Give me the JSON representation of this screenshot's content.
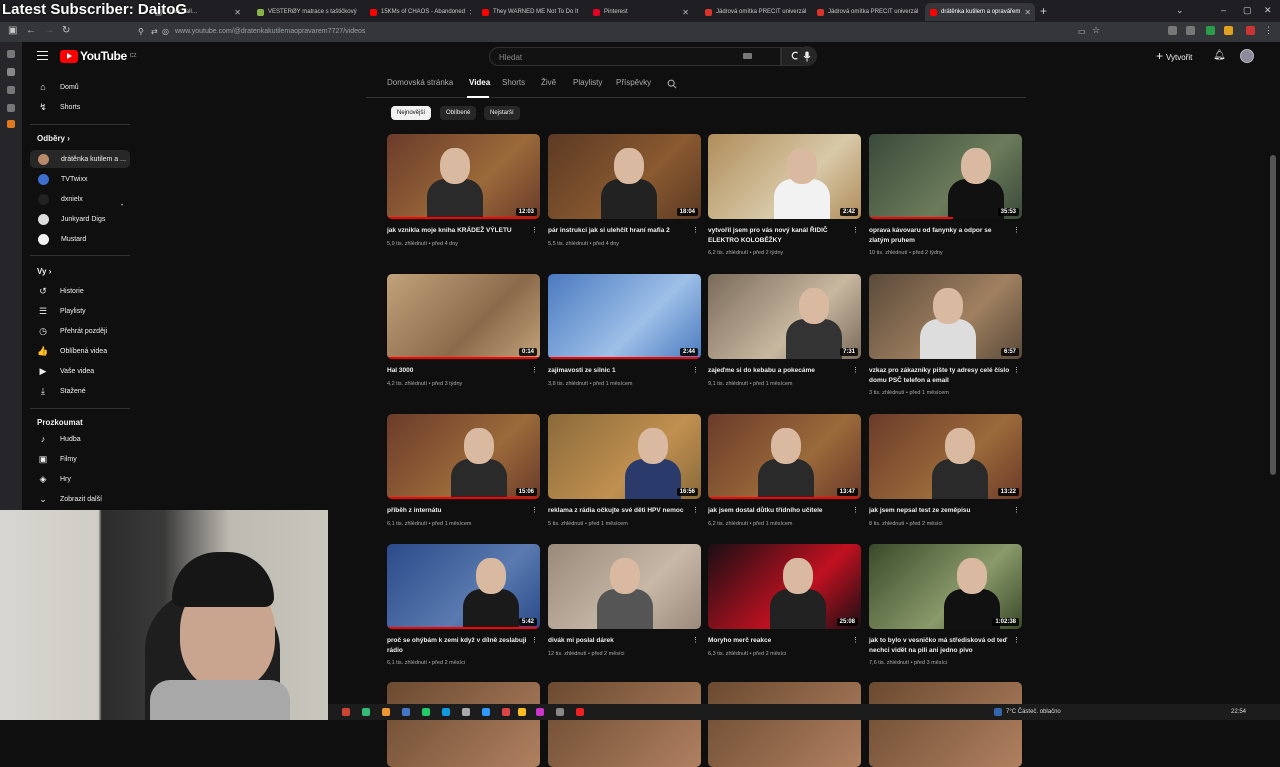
{
  "overlay": {
    "title": "Latest Subscriber: DaitoG"
  },
  "browser": {
    "tabs": [
      {
        "label": "Track, fall…",
        "color": "#6b6b6b",
        "active": false
      },
      {
        "label": "VESTERØY matrace s taštičkový",
        "color": "#8ab34a",
        "active": false
      },
      {
        "label": "15KMs of CHAOS - Abandoned",
        "color": "#ff0000",
        "active": false
      },
      {
        "label": "They WARNED ME Not To Do It",
        "color": "#ff0000",
        "active": false
      },
      {
        "label": "Pinterest",
        "color": "#e60023",
        "active": false
      },
      {
        "label": "Jádrová omítka PRECIT univerzál",
        "color": "#d9342b",
        "active": false
      },
      {
        "label": "Jádrová omítka PRECIT univerzál",
        "color": "#d9342b",
        "active": false
      },
      {
        "label": "drátěnka kutilem a opravářem",
        "color": "#ff0000",
        "active": true
      }
    ],
    "url": "www.youtube.com/@dratenkakutilemaopravarem7727/videos"
  },
  "masthead": {
    "logo_text": "YouTube",
    "logo_country": "CZ",
    "search_placeholder": "Hledat",
    "create_label": "Vytvořit"
  },
  "sidebar": {
    "home": "Domů",
    "shorts": "Shorts",
    "subs_header": "Odběry",
    "subscriptions": [
      {
        "label": "drátěnka kutilem a ...",
        "color": "#b88a6a"
      },
      {
        "label": "TVTwixx",
        "color": "#3d6fd1"
      },
      {
        "label": "dxnielx",
        "color": "#222222"
      },
      {
        "label": "Junkyard Digs",
        "color": "#dddddd"
      },
      {
        "label": "Mustard",
        "color": "#f2f2f2"
      }
    ],
    "you_header": "Vy",
    "you_items": [
      {
        "label": "Historie",
        "icon": "history-icon",
        "glyph": "↺"
      },
      {
        "label": "Playlisty",
        "icon": "playlist-icon",
        "glyph": "☰"
      },
      {
        "label": "Přehrát později",
        "icon": "clock-icon",
        "glyph": "◷"
      },
      {
        "label": "Oblíbená videa",
        "icon": "thumb-up-icon",
        "glyph": "👍"
      },
      {
        "label": "Vaše videa",
        "icon": "your-videos-icon",
        "glyph": "▶"
      },
      {
        "label": "Stažené",
        "icon": "download-icon",
        "glyph": "⤓"
      }
    ],
    "explore_header": "Prozkoumat",
    "explore_items": [
      {
        "label": "Hudba",
        "icon": "music-icon",
        "glyph": "♪"
      },
      {
        "label": "Filmy",
        "icon": "film-icon",
        "glyph": "▣"
      },
      {
        "label": "Hry",
        "icon": "gaming-icon",
        "glyph": "◈"
      },
      {
        "label": "Zobrazit další",
        "icon": "chevron-down-icon",
        "glyph": "⌄"
      }
    ]
  },
  "channel_tabs": [
    "Domovská stránka",
    "Videa",
    "Shorts",
    "Živě",
    "Playlisty",
    "Příspěvky"
  ],
  "chips": [
    "Nejnovější",
    "Oblíbené",
    "Nejstarší"
  ],
  "videos": [
    {
      "title": "jak vznikla moje kniha KRÁDEŽ VÝLETU",
      "meta": "5,9 tis. zhlédnutí • před 4 dny",
      "duration": "12:03",
      "progress": 1.0
    },
    {
      "title": "pár instrukcí jak si ulehčit hraní mafia 2",
      "meta": "5,5 tis. zhlédnutí • před 4 dny",
      "duration": "18:04",
      "progress": 0
    },
    {
      "title": "vytvořil jsem pro vás nový kanál ŘIDIČ ELEKTRO KOLOBĚŽKY",
      "meta": "6,2 tis. zhlédnutí • před 2 týdny",
      "duration": "2:42",
      "progress": 0
    },
    {
      "title": "oprava kávovaru od fanynky a odpor se zlatým pruhem",
      "meta": "10 tis. zhlédnutí • před 2 týdny",
      "duration": "35:53",
      "progress": 0.55
    },
    {
      "title": "Hal 3000",
      "meta": "4,2 tis. zhlédnutí • před 3 týdny",
      "duration": "0:14",
      "progress": 1.0
    },
    {
      "title": "zajímavosti ze silnic 1",
      "meta": "3,8 tis. zhlédnutí • před 1 měsícem",
      "duration": "2:44",
      "progress": 1.0
    },
    {
      "title": "zajeďme si do kebabu a pokecáme",
      "meta": "9,1 tis. zhlédnutí • před 1 měsícem",
      "duration": "7:31",
      "progress": 0
    },
    {
      "title": "vzkaz pro zákazníky pište ty adresy celé číslo domu PSČ telefon a email",
      "meta": "3 tis. zhlédnutí • před 1 měsícem",
      "duration": "6:57",
      "progress": 0
    },
    {
      "title": "příběh z internátu",
      "meta": "6,1 tis. zhlédnutí • před 1 měsícem",
      "duration": "15:06",
      "progress": 1.0
    },
    {
      "title": "reklama z rádia očkujte své děti HPV nemoc",
      "meta": "5 tis. zhlédnutí • před 1 měsícem",
      "duration": "16:56",
      "progress": 0
    },
    {
      "title": "jak jsem dostal důtku třídního učitele",
      "meta": "6,2 tis. zhlédnutí • před 1 měsícem",
      "duration": "13:47",
      "progress": 1.0
    },
    {
      "title": "jak jsem nepsal test ze zeměpisu",
      "meta": "8 tis. zhlédnutí • před 2 měsíci",
      "duration": "13:22",
      "progress": 0
    },
    {
      "title": "proč se ohýbám k zemi když v dílně zeslabuji rádio",
      "meta": "6,1 tis. zhlédnutí • před 2 měsíci",
      "duration": "5:42",
      "progress": 1.0
    },
    {
      "title": "divák mi poslal dárek",
      "meta": "12 tis. zhlédnutí • před 2 měsíci",
      "duration": "",
      "progress": 0
    },
    {
      "title": "Moryho merč reakce",
      "meta": "6,3 tis. zhlédnutí • před 2 měsíci",
      "duration": "25:08",
      "progress": 0
    },
    {
      "title": "jak to bylo v vesničko má středisková od teď nechci vidět na pili ani jedno pivo",
      "meta": "7,6 tis. zhlédnutí • před 3 měsíci",
      "duration": "1:02:38",
      "progress": 0
    }
  ],
  "taskbar": {
    "weather": "7°C  Částeč. oblačno",
    "time": "22:54"
  }
}
